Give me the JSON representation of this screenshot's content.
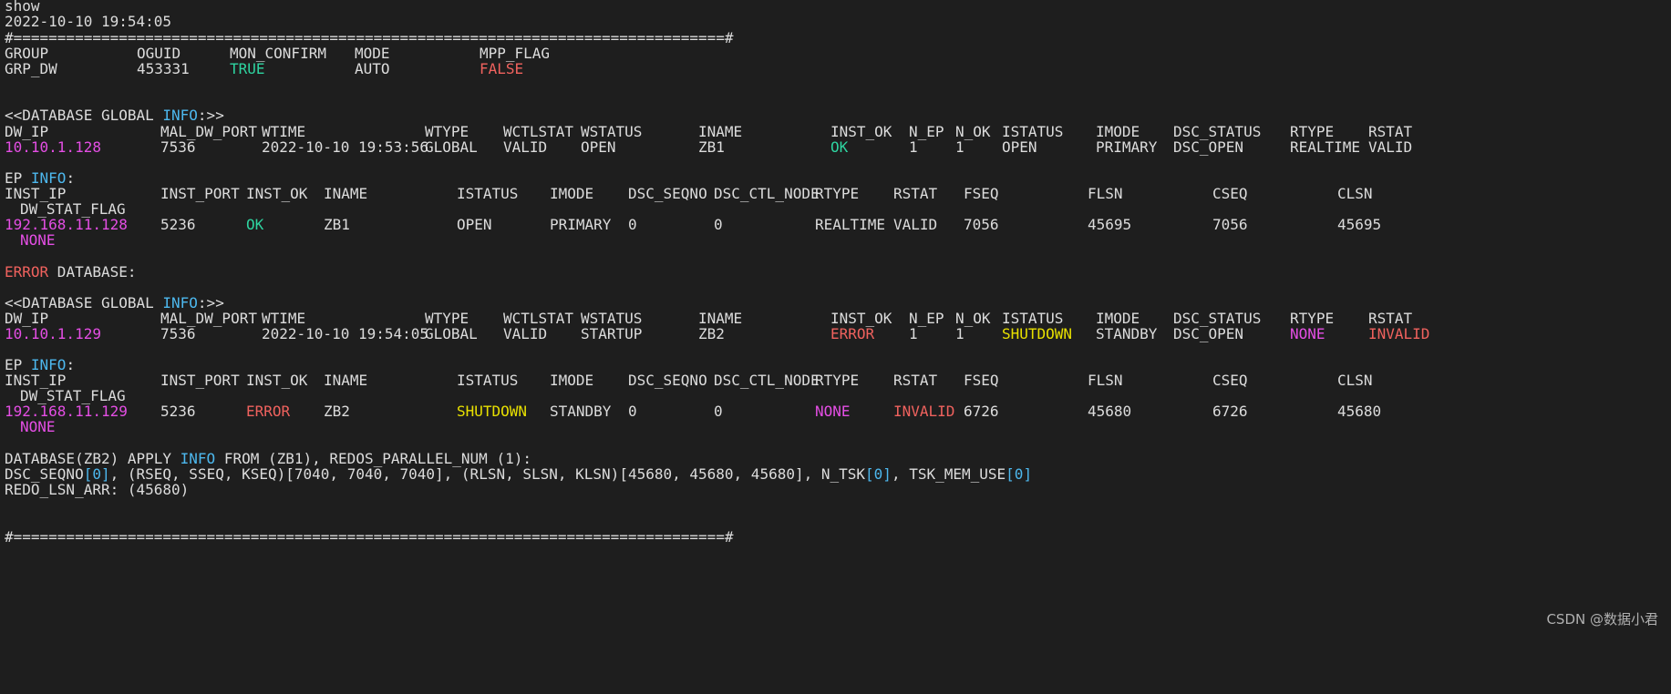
{
  "window": {
    "watermark": "CSDN @数据小君"
  },
  "colors": {
    "text": "#dcdcdc",
    "green": "#2ed4a0",
    "red": "#f0625e",
    "magenta": "#e44ee4",
    "blue": "#4db8ee",
    "yellow": "#e8e000",
    "background": "#1e1e1e"
  },
  "header": {
    "command": "show",
    "timestamp": "2022-10-10 19:54:05",
    "separator": "#=================================================================================#"
  },
  "group": {
    "headers": [
      "GROUP",
      "OGUID",
      "MON_CONFIRM",
      "MODE",
      "MPP_FLAG"
    ],
    "values": [
      "GRP_DW",
      "453331",
      "TRUE",
      "AUTO",
      "FALSE"
    ]
  },
  "db1": {
    "title_prefix": "<<DATABASE GLOBAL ",
    "title_info": "INFO",
    "title_suffix": ":>>",
    "headers": [
      "DW_IP",
      "MAL_DW_PORT",
      "WTIME",
      "WTYPE",
      "WCTLSTAT",
      "WSTATUS",
      "INAME",
      "INST_OK",
      "N_EP",
      "N_OK",
      "ISTATUS",
      "IMODE",
      "DSC_STATUS",
      "RTYPE",
      "RSTAT"
    ],
    "values": [
      "10.10.1.128",
      "7536",
      "2022-10-10 19:53:56",
      "GLOBAL",
      "VALID",
      "OPEN",
      "ZB1",
      "OK",
      "1",
      "1",
      "OPEN",
      "PRIMARY",
      "DSC_OPEN",
      "REALTIME",
      "VALID"
    ],
    "ep_prefix": "EP ",
    "ep_info": "INFO",
    "ep_suffix": ":",
    "ep_headers": [
      "INST_IP",
      "INST_PORT",
      "INST_OK",
      "INAME",
      "ISTATUS",
      "IMODE",
      "DSC_SEQNO",
      "DSC_CTL_NODE",
      "RTYPE",
      "RSTAT",
      "FSEQ",
      "FLSN",
      "CSEQ",
      "CLSN"
    ],
    "ep_header2": "DW_STAT_FLAG",
    "ep_values": [
      "192.168.11.128",
      "5236",
      "OK",
      "ZB1",
      "OPEN",
      "PRIMARY",
      "0",
      "0",
      "REALTIME",
      "VALID",
      "7056",
      "45695",
      "7056",
      "45695"
    ],
    "ep_value2": "NONE"
  },
  "error_line": {
    "error": "ERROR",
    "rest": " DATABASE:"
  },
  "db2": {
    "title_prefix": "<<DATABASE GLOBAL ",
    "title_info": "INFO",
    "title_suffix": ":>>",
    "headers": [
      "DW_IP",
      "MAL_DW_PORT",
      "WTIME",
      "WTYPE",
      "WCTLSTAT",
      "WSTATUS",
      "INAME",
      "INST_OK",
      "N_EP",
      "N_OK",
      "ISTATUS",
      "IMODE",
      "DSC_STATUS",
      "RTYPE",
      "RSTAT"
    ],
    "values": [
      "10.10.1.129",
      "7536",
      "2022-10-10 19:54:05",
      "GLOBAL",
      "VALID",
      "STARTUP",
      "ZB2",
      "ERROR",
      "1",
      "1",
      "SHUTDOWN",
      "STANDBY",
      "DSC_OPEN",
      "NONE",
      "INVALID"
    ],
    "ep_prefix": "EP ",
    "ep_info": "INFO",
    "ep_suffix": ":",
    "ep_headers": [
      "INST_IP",
      "INST_PORT",
      "INST_OK",
      "INAME",
      "ISTATUS",
      "IMODE",
      "DSC_SEQNO",
      "DSC_CTL_NODE",
      "RTYPE",
      "RSTAT",
      "FSEQ",
      "FLSN",
      "CSEQ",
      "CLSN"
    ],
    "ep_header2": "DW_STAT_FLAG",
    "ep_values": [
      "192.168.11.129",
      "5236",
      "ERROR",
      "ZB2",
      "SHUTDOWN",
      "STANDBY",
      "0",
      "0",
      "NONE",
      "INVALID",
      "6726",
      "45680",
      "6726",
      "45680"
    ],
    "ep_value2": "NONE"
  },
  "apply": {
    "line1": [
      "DATABASE(ZB2) APPLY ",
      "INFO",
      " FROM (ZB1), REDOS_PARALLEL_NUM (1):"
    ],
    "line2": [
      "DSC_SEQNO",
      "[0]",
      ", (RSEQ, SSEQ, KSEQ)[7040, 7040, 7040], (RLSN, SLSN, KLSN)[45680, 45680, 45680], N_TSK",
      "[0]",
      ", TSK_MEM_USE",
      "[0]"
    ],
    "line3": "REDO_LSN_ARR: (45680)"
  }
}
